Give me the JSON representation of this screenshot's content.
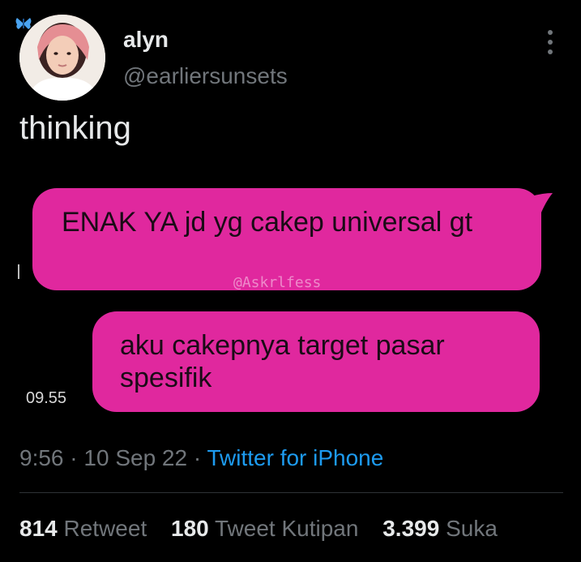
{
  "author": {
    "display_name": "alyn",
    "handle": "@earliersunsets"
  },
  "tweet": {
    "text": "thinking"
  },
  "attachment": {
    "messages": [
      {
        "text": "ENAK YA jd yg cakep universal gt",
        "side": "right"
      },
      {
        "text": "aku cakepnya target pasar spesifik",
        "side": "right"
      }
    ],
    "watermark": "@Askrlfess",
    "time": "09.55",
    "bubble_color": "#e0289e"
  },
  "meta": {
    "time": "9:56",
    "separator": "·",
    "date": "10 Sep 22",
    "source": "Twitter for iPhone"
  },
  "stats": {
    "retweets_count": "814",
    "retweets_label": "Retweet",
    "quotes_count": "180",
    "quotes_label": "Tweet Kutipan",
    "likes_count": "3.399",
    "likes_label": "Suka"
  },
  "colors": {
    "background": "#000000",
    "text_primary": "#e7e9ea",
    "text_secondary": "#71767b",
    "link": "#1d9bf0"
  }
}
